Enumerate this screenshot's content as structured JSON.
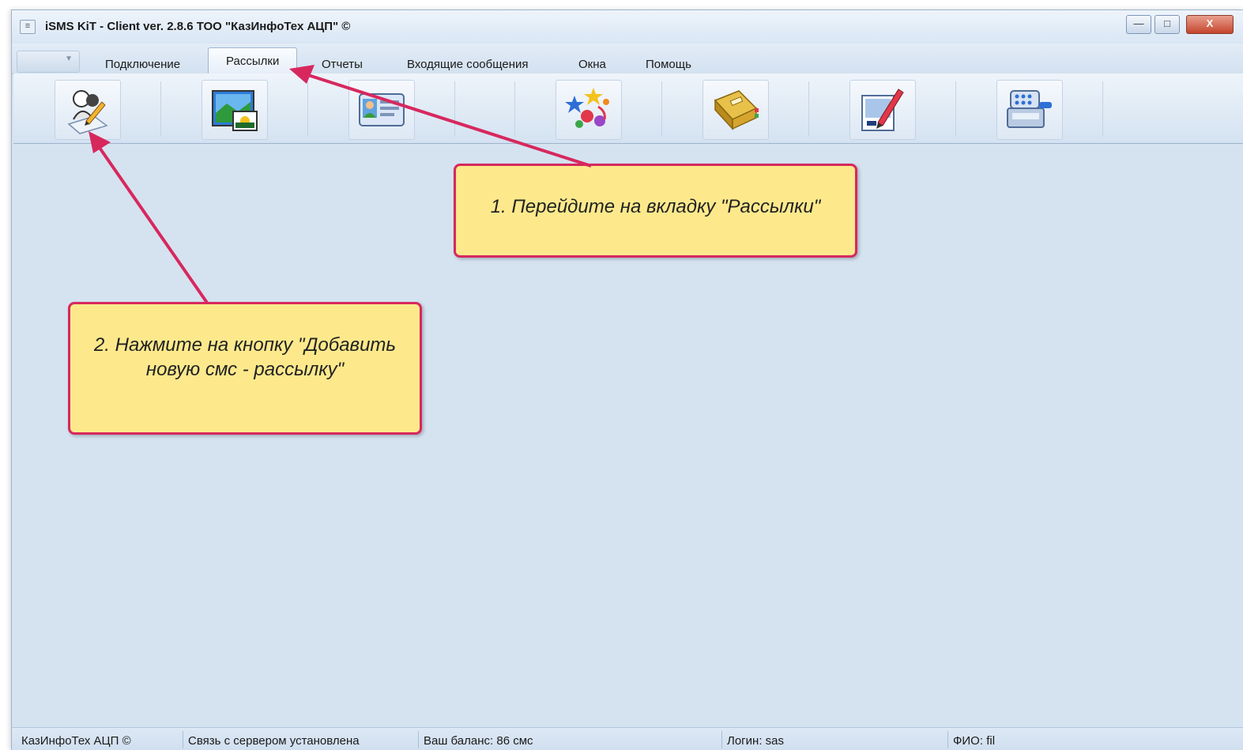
{
  "window": {
    "title": "iSMS KiT - Client ver. 2.8.6 ТОО \"КазИнфоТех АЦП\" ©",
    "min_glyph": "—",
    "max_glyph": "□",
    "close_glyph": "X"
  },
  "menu": {
    "tabs": [
      {
        "label": "Подключение"
      },
      {
        "label": "Рассылки",
        "active": true
      },
      {
        "label": "Отчеты"
      },
      {
        "label": "Входящие сообщения"
      },
      {
        "label": "Окна"
      },
      {
        "label": "Помощь"
      }
    ]
  },
  "ribbon": {
    "buttons": [
      {
        "icon": "add-sms-mailing-icon"
      },
      {
        "icon": "picture-icon"
      },
      {
        "icon": "contact-card-icon"
      },
      {
        "icon": "celebration-icon"
      },
      {
        "icon": "address-book-icon"
      },
      {
        "icon": "edit-template-icon"
      },
      {
        "icon": "cash-register-icon"
      }
    ]
  },
  "annotations": {
    "step1": "1. Перейдите на вкладку \"Рассылки\"",
    "step2_line1": "2. Нажмите на кнопку \"Добавить",
    "step2_line2": "новую смс - рассылку\""
  },
  "status": {
    "company": "КазИнфоТех АЦП ©",
    "connection": "Связь с сервером установлена",
    "balance": "Ваш баланс: 86 смс",
    "login": "Логин: sas",
    "fio": "ФИО: fil"
  },
  "colors": {
    "workspace": "#d5e3f1",
    "callout_fill": "#fde98c",
    "callout_border": "#d7285e",
    "arrow": "#d7285e"
  }
}
